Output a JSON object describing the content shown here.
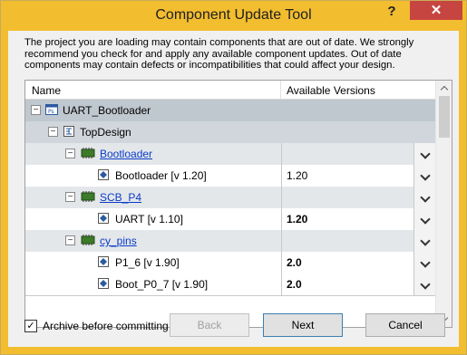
{
  "window": {
    "title": "Component Update Tool",
    "help_label": "?",
    "close_label": "✕"
  },
  "description": "The project you are loading may contain components that are out of date. We strongly recommend you check for and apply any available component updates. Out of date components may contain defects or incompatibilities that could affect your design.",
  "grid": {
    "columns": {
      "name": "Name",
      "versions": "Available Versions"
    },
    "rows": [
      {
        "label": "UART_Bootloader",
        "type": "project",
        "expander": "−"
      },
      {
        "label": "TopDesign",
        "type": "schematic",
        "expander": "−"
      },
      {
        "label": "Bootloader",
        "type": "component",
        "expander": "−",
        "version": ""
      },
      {
        "label": "Bootloader [v 1.20]",
        "type": "instance",
        "version": "1.20",
        "version_bold": false
      },
      {
        "label": "SCB_P4",
        "type": "component",
        "expander": "−",
        "version": ""
      },
      {
        "label": "UART [v 1.10]",
        "type": "instance",
        "version": "1.20",
        "version_bold": true
      },
      {
        "label": "cy_pins",
        "type": "component",
        "expander": "−",
        "version": ""
      },
      {
        "label": "P1_6 [v 1.90]",
        "type": "instance",
        "version": "2.0",
        "version_bold": true
      },
      {
        "label": "Boot_P0_7 [v 1.90]",
        "type": "instance",
        "version": "2.0",
        "version_bold": true
      }
    ]
  },
  "archive": {
    "label": "Archive before committing",
    "checked": true,
    "mark": "✓"
  },
  "buttons": {
    "back": "Back",
    "next": "Next",
    "cancel": "Cancel"
  },
  "colors": {
    "title_bar": "#f2bd2f",
    "close_button": "#c74540",
    "link": "#0a3cc8"
  }
}
